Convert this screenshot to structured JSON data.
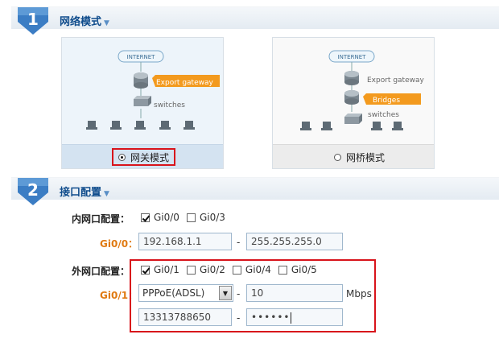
{
  "step1": {
    "number": "1",
    "title": "网络模式",
    "caret": "▼"
  },
  "step2": {
    "number": "2",
    "title": "接口配置",
    "caret": "▼"
  },
  "modes": {
    "gateway": {
      "label": "网关模式",
      "selected": true,
      "diagram": {
        "internet": "INTERNET",
        "export_gateway": "Export gateway",
        "switches": "switches"
      }
    },
    "bridge": {
      "label": "网桥模式",
      "selected": false,
      "diagram": {
        "internet": "INTERNET",
        "export_gateway": "Export gateway",
        "bridges": "Bridges",
        "switches": "switches"
      }
    }
  },
  "lan": {
    "label": "内网口配置：",
    "ports": [
      {
        "name": "Gi0/0",
        "checked": true
      },
      {
        "name": "Gi0/3",
        "checked": false
      }
    ],
    "port_label": "Gi0/0：",
    "ip": "192.168.1.1",
    "mask": "255.255.255.0",
    "separator": "-"
  },
  "wan": {
    "label": "外网口配置：",
    "ports": [
      {
        "name": "Gi0/1",
        "checked": true
      },
      {
        "name": "Gi0/2",
        "checked": false
      },
      {
        "name": "Gi0/4",
        "checked": false
      },
      {
        "name": "Gi0/5",
        "checked": false
      }
    ],
    "port_label": "Gi0/1：",
    "mode_select": "PPPoE(ADSL)",
    "bandwidth": "10",
    "bandwidth_unit": "Mbps",
    "username": "13313788650",
    "password_mask": "••••••",
    "separator": "-"
  },
  "colors": {
    "accent": "#0f4c8c",
    "highlight": "#d8141b",
    "port_label": "#e07a12",
    "tag_orange": "#f39a1e"
  }
}
